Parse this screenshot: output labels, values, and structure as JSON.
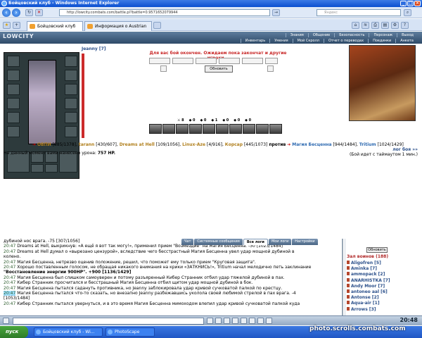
{
  "window": {
    "title": "Бойцовский клуб - Windows Internet Explorer"
  },
  "browser": {
    "url": "http://lowcity.combats.com/battle.pl?battle=0.9571652079944",
    "search_placeholder": "Яндекс",
    "tabs": [
      {
        "label": "Бойцовский клуб"
      },
      {
        "label": "Информация о Austrian"
      }
    ]
  },
  "game_header": {
    "logo": "LOWCITY",
    "menu_top": [
      "Знания",
      "Общение",
      "Безопасность",
      "Персонаж",
      "Выход"
    ],
    "menu_bottom": [
      "Инвентарь",
      "Умения",
      "Мой Скролл",
      "Отчет о переводах",
      "Поединки",
      "Анкета"
    ]
  },
  "battle": {
    "player_name": "Jeanny [7]",
    "waiting_message": "Для вас бой окончен. Ожидаем пока закончат и другие игроки...",
    "refresh_label": "Обновить",
    "counters": [
      "8",
      "0",
      "0",
      "1",
      "0",
      "0",
      "0"
    ],
    "team1": [
      {
        "name": "ОВПИ",
        "hp": "[885/1378]"
      },
      {
        "name": "tarann",
        "hp": "[430/607]"
      },
      {
        "name": "Dreams at Hell",
        "hp": "[109/1056]"
      },
      {
        "name": "Linux-Aze",
        "hp": "[4/916]"
      },
      {
        "name": "Корсар",
        "hp": "[445/1073]"
      }
    ],
    "versus": "против",
    "team2": [
      {
        "name": "Магия Бесценна",
        "hp": "[944/1484]"
      },
      {
        "name": "Tritium",
        "hp": "[1024/1429]"
      }
    ],
    "damage_text": "На данный момент вами нанесено урона:",
    "damage_value": "757 HP.",
    "log_link": "лог боя »»",
    "timeout_text": "(Бой идет с таймаутом 1 мин.)"
  },
  "chat": {
    "tabs": [
      "Чат",
      "Системные сообщения",
      "Все логи",
      "Мои логи",
      "Настройки"
    ],
    "active_tab": "Все логи",
    "lines": [
      {
        "time": "",
        "text": "дубиной нос врага. -75 [307/1056]"
      },
      {
        "time": "20:47",
        "text": "Dreams at Hell, выкрикнув: «А ещё я вот так могу!», применил прием \"Возмездие\" на Магия Бесценна. -30 [1023/1484]"
      },
      {
        "time": "20:47",
        "text": "Dreams at Hell думал о «вырезано цензурой», вследствие чего бесстрастный Магия Бесценна увел удар мощной дубиной в"
      },
      {
        "time": "",
        "text": "колено."
      },
      {
        "time": "20:47",
        "text": "Магия Бесценна, нетрезво оценив положение, решил, что поможет ему только прием \"Круговая защита\"."
      },
      {
        "time": "20:47",
        "text": "Хорошо поставленным голосом, не обращая никакого внимания на крики «ЗАТКНИСЬ!», Tritium начал мелодично петь заклинание"
      },
      {
        "time": "",
        "text": "\"Восстановление энергии 900HP\". +900 [1136/1429]"
      },
      {
        "time": "20:47",
        "text": "Магия Бесценна был слишком самоуверен и потому разъяренный Кибер Странник отбил удар тяжелой дубиной в пах."
      },
      {
        "time": "20:47",
        "text": "Кибер Странник просчитался и бесстрашный Магия Бесценна отбил щитом удар мощной дубиной в бок."
      },
      {
        "time": "20:47",
        "text": "Магия Бесценна пытался садануть противника, но Jeanny заблокировала удар кривой сучковатой палкой по крестцу."
      },
      {
        "time": "20:47",
        "text": "Магия Бесценна пытался что-то сказать, но внезапно Jeanny разбежавшись уколола своей любимой стрелой в пах врага. -4"
      },
      {
        "time": "",
        "text": "[1053/1484]"
      },
      {
        "time": "20:47",
        "text": "Кибер Странник пытался увернуться, и в это время Магия Бесценна мимоходом влепил удар кривой сучковатой палкой куда"
      }
    ]
  },
  "room": {
    "refresh_label": "Обновить",
    "title": "Зал воинов (188)",
    "players": [
      "Aligofren [5]",
      "Aminka [7]",
      "ammopack [2]",
      "ANARHISTKA [7]",
      "Andy Moor [7]",
      "antoneo aal [6]",
      "Antonse [2]",
      "Aqua-air [1]",
      "Arrows [3]"
    ]
  },
  "statusbar": {
    "clock": "20:48"
  },
  "taskbar": {
    "start": "пуск",
    "tasks": [
      "Бойцовский клуб - Wi...",
      "PhotoScape"
    ]
  },
  "watermark": "photo.scrolls.combats.com"
}
